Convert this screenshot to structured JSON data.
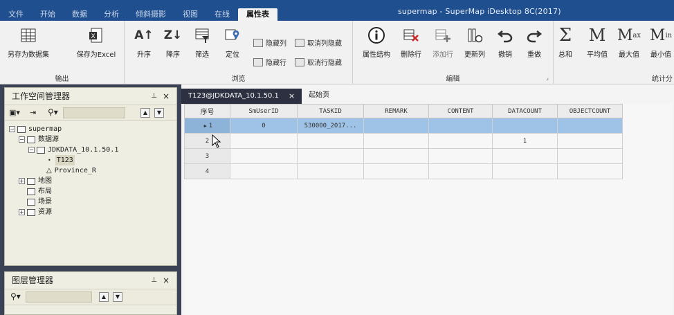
{
  "window": {
    "title": "supermap - SuperMap iDesktop 8C(2017)",
    "tabs": [
      "文件",
      "开始",
      "数据",
      "分析",
      "倾斜摄影",
      "视图",
      "在线",
      "属性表"
    ],
    "active_tab": "属性表"
  },
  "ribbon": {
    "output": {
      "label": "输出",
      "save_dataset": "另存为数据集",
      "save_excel": "保存为Excel"
    },
    "browse": {
      "label": "浏览",
      "asc": "升序",
      "desc": "降序",
      "filter": "筛选",
      "locate": "定位",
      "hide_col": "隐藏列",
      "unhide_col": "取消列隐藏",
      "hide_row": "隐藏行",
      "unhide_row": "取消行隐藏"
    },
    "edit": {
      "label": "编辑",
      "attr_struct": "属性结构",
      "delete_row": "删除行",
      "add_row": "添加行",
      "update_col": "更新列",
      "undo": "撤销",
      "redo": "重做"
    },
    "stats": {
      "label": "统计分",
      "sum": "总和",
      "avg": "平均值",
      "max": "最大值",
      "min": "最小值"
    }
  },
  "workspace_panel": {
    "title": "工作空间管理器",
    "tree": [
      "supermap",
      "数据源",
      "JDKDATA_10.1.50.1",
      "T123",
      "Province_R",
      "地图",
      "布局",
      "场景",
      "资源"
    ]
  },
  "layer_panel": {
    "title": "图层管理器"
  },
  "doc_tabs": [
    "T123@JDKDATA_10.1.50.1",
    "起始页"
  ],
  "grid": {
    "columns": [
      "序号",
      "SmUserID",
      "TASKID",
      "REMARK",
      "CONTENT",
      "DATACOUNT",
      "OBJECTCOUNT"
    ],
    "rows": [
      [
        "1",
        "0",
        "530000_2017...",
        "",
        "",
        "",
        ""
      ],
      [
        "2",
        "",
        "",
        "",
        "",
        "1",
        ""
      ],
      [
        "3",
        "",
        "",
        "",
        "",
        "",
        ""
      ],
      [
        "4",
        "",
        "",
        "",
        "",
        "",
        ""
      ]
    ],
    "selected_row": 1
  },
  "colors": {
    "title_bar": "#1f4f8f",
    "selection": "#9fc3e6",
    "panel_bg": "#efeee2"
  }
}
